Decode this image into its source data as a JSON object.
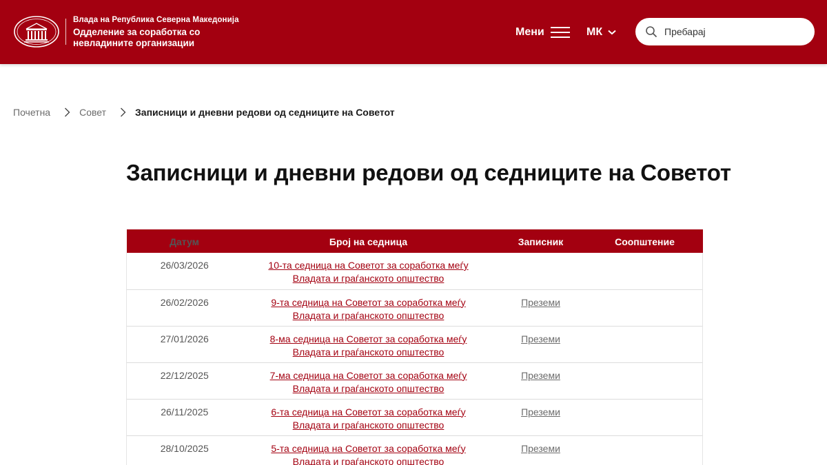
{
  "header": {
    "org_line1": "Влада на Република Северна Македонија",
    "org_line2": "Одделение за соработка со невладините организации",
    "menu_label": "Мени",
    "lang_label": "МК",
    "search_placeholder": "Пребарај",
    "colors": {
      "brand": "#a30010",
      "text_on_brand": "#ffffff"
    },
    "icons": [
      "government-emblem-icon",
      "hamburger-icon",
      "chevron-down-icon",
      "search-icon"
    ]
  },
  "breadcrumb": {
    "items": [
      "Почетна",
      "Совет"
    ],
    "current": "Записници и дневни редови од седниците на Советот"
  },
  "page_title": "Записници и дневни редови од седниците на Советот",
  "table": {
    "headers": [
      "Датум",
      "Број на седница",
      "Записник",
      "Соопштение"
    ],
    "rows": [
      {
        "date": "26/03/2026",
        "session_line1": "10-та седница на Советот за соработка меѓу",
        "session_line2": "Владата и граѓанското општество",
        "minutes": ""
      },
      {
        "date": "26/02/2026",
        "session_line1": "9-та седница на Советот за соработка меѓу",
        "session_line2": "Владата и граѓанското општество",
        "minutes": "Преземи"
      },
      {
        "date": "27/01/2026",
        "session_line1": "8-ма седница на Советот за соработка меѓу",
        "session_line2": "Владата и граѓанското општество",
        "minutes": "Преземи"
      },
      {
        "date": "22/12/2025",
        "session_line1": "7-ма седница на Советот за соработка меѓу",
        "session_line2": "Владата и граѓанското општество",
        "minutes": "Преземи"
      },
      {
        "date": "26/11/2025",
        "session_line1": "6-та седница на Советот за соработка меѓу",
        "session_line2": "Владата и граѓанското општество",
        "minutes": "Преземи"
      },
      {
        "date": "28/10/2025",
        "session_line1": "5-та седница на Советот за соработка меѓу",
        "session_line2": "Владата и граѓанското општество",
        "minutes": "Преземи"
      }
    ]
  }
}
